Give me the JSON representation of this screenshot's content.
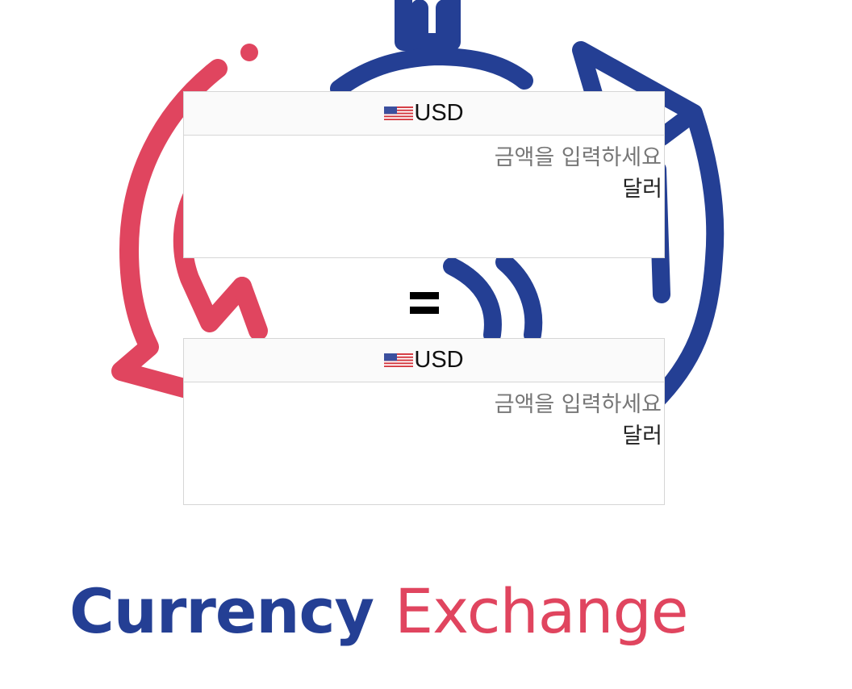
{
  "converter": {
    "from": {
      "currency_code": "USD",
      "flag_icon": "us-flag-icon",
      "amount_value": "",
      "amount_placeholder": "금액을 입력하세요",
      "unit_label": "달러"
    },
    "equals_symbol": "=",
    "to": {
      "currency_code": "USD",
      "flag_icon": "us-flag-icon",
      "amount_value": "",
      "amount_placeholder": "금액을 입력하세요",
      "unit_label": "달러"
    }
  },
  "brand": {
    "word1": "Currency",
    "word2": "Exchange",
    "color_primary": "#243f94",
    "color_accent": "#e0455f"
  }
}
